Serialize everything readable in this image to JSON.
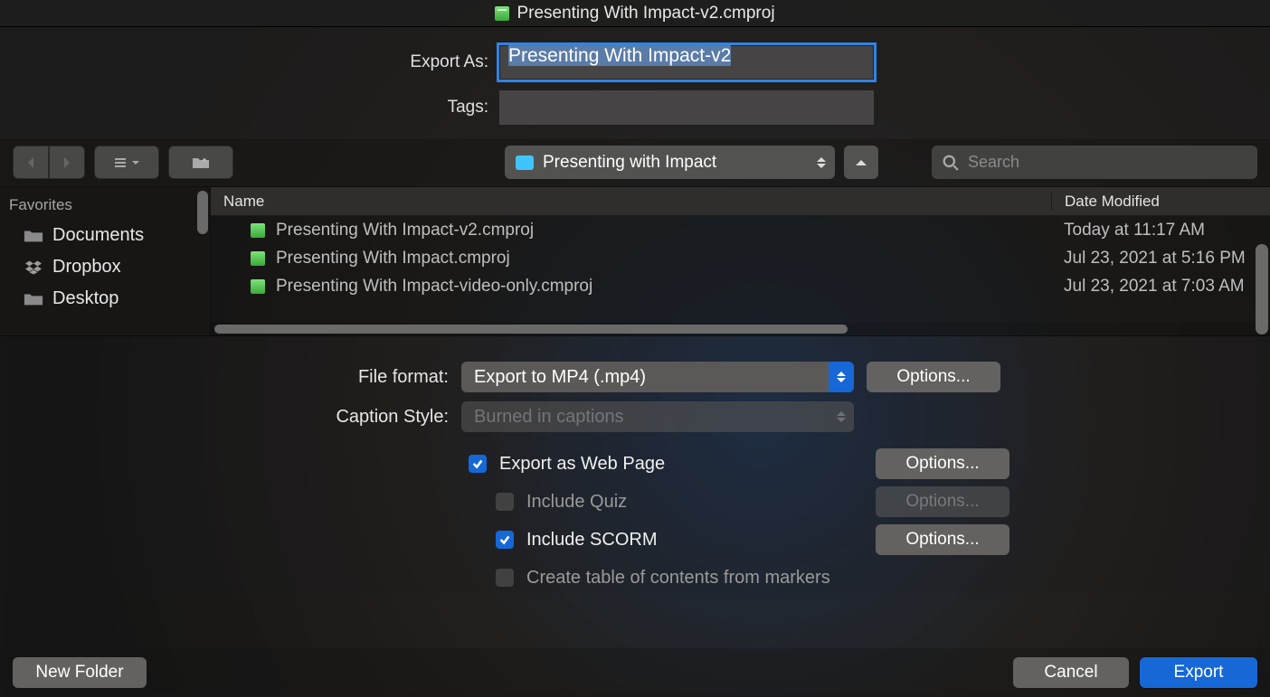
{
  "window": {
    "title": "Presenting With Impact-v2.cmproj"
  },
  "exportAs": {
    "label": "Export As:",
    "value": "Presenting With Impact-v2"
  },
  "tags": {
    "label": "Tags:",
    "value": ""
  },
  "toolbar": {
    "currentFolder": "Presenting with Impact",
    "searchPlaceholder": "Search"
  },
  "sidebar": {
    "header": "Favorites",
    "items": [
      {
        "label": "Documents",
        "icon": "folder"
      },
      {
        "label": "Dropbox",
        "icon": "dropbox"
      },
      {
        "label": "Desktop",
        "icon": "folder"
      }
    ]
  },
  "columns": {
    "name": "Name",
    "date": "Date Modified"
  },
  "files": [
    {
      "name": "Presenting With Impact-v2.cmproj",
      "date": "Today at 11:17 AM"
    },
    {
      "name": "Presenting With Impact.cmproj",
      "date": "Jul 23, 2021 at 5:16 PM"
    },
    {
      "name": "Presenting With Impact-video-only.cmproj",
      "date": "Jul 23, 2021 at 7:03 AM"
    }
  ],
  "options": {
    "fileFormat": {
      "label": "File format:",
      "value": "Export to MP4 (.mp4)",
      "button": "Options..."
    },
    "captionStyle": {
      "label": "Caption Style:",
      "value": "Burned in captions"
    },
    "exportWeb": {
      "label": "Export as Web Page",
      "checked": true,
      "button": "Options..."
    },
    "includeQuiz": {
      "label": "Include Quiz",
      "checked": false,
      "button": "Options..."
    },
    "includeScorm": {
      "label": "Include SCORM",
      "checked": true,
      "button": "Options..."
    },
    "createToc": {
      "label": "Create table of contents from markers",
      "checked": false
    }
  },
  "footer": {
    "newFolder": "New Folder",
    "cancel": "Cancel",
    "export": "Export"
  }
}
